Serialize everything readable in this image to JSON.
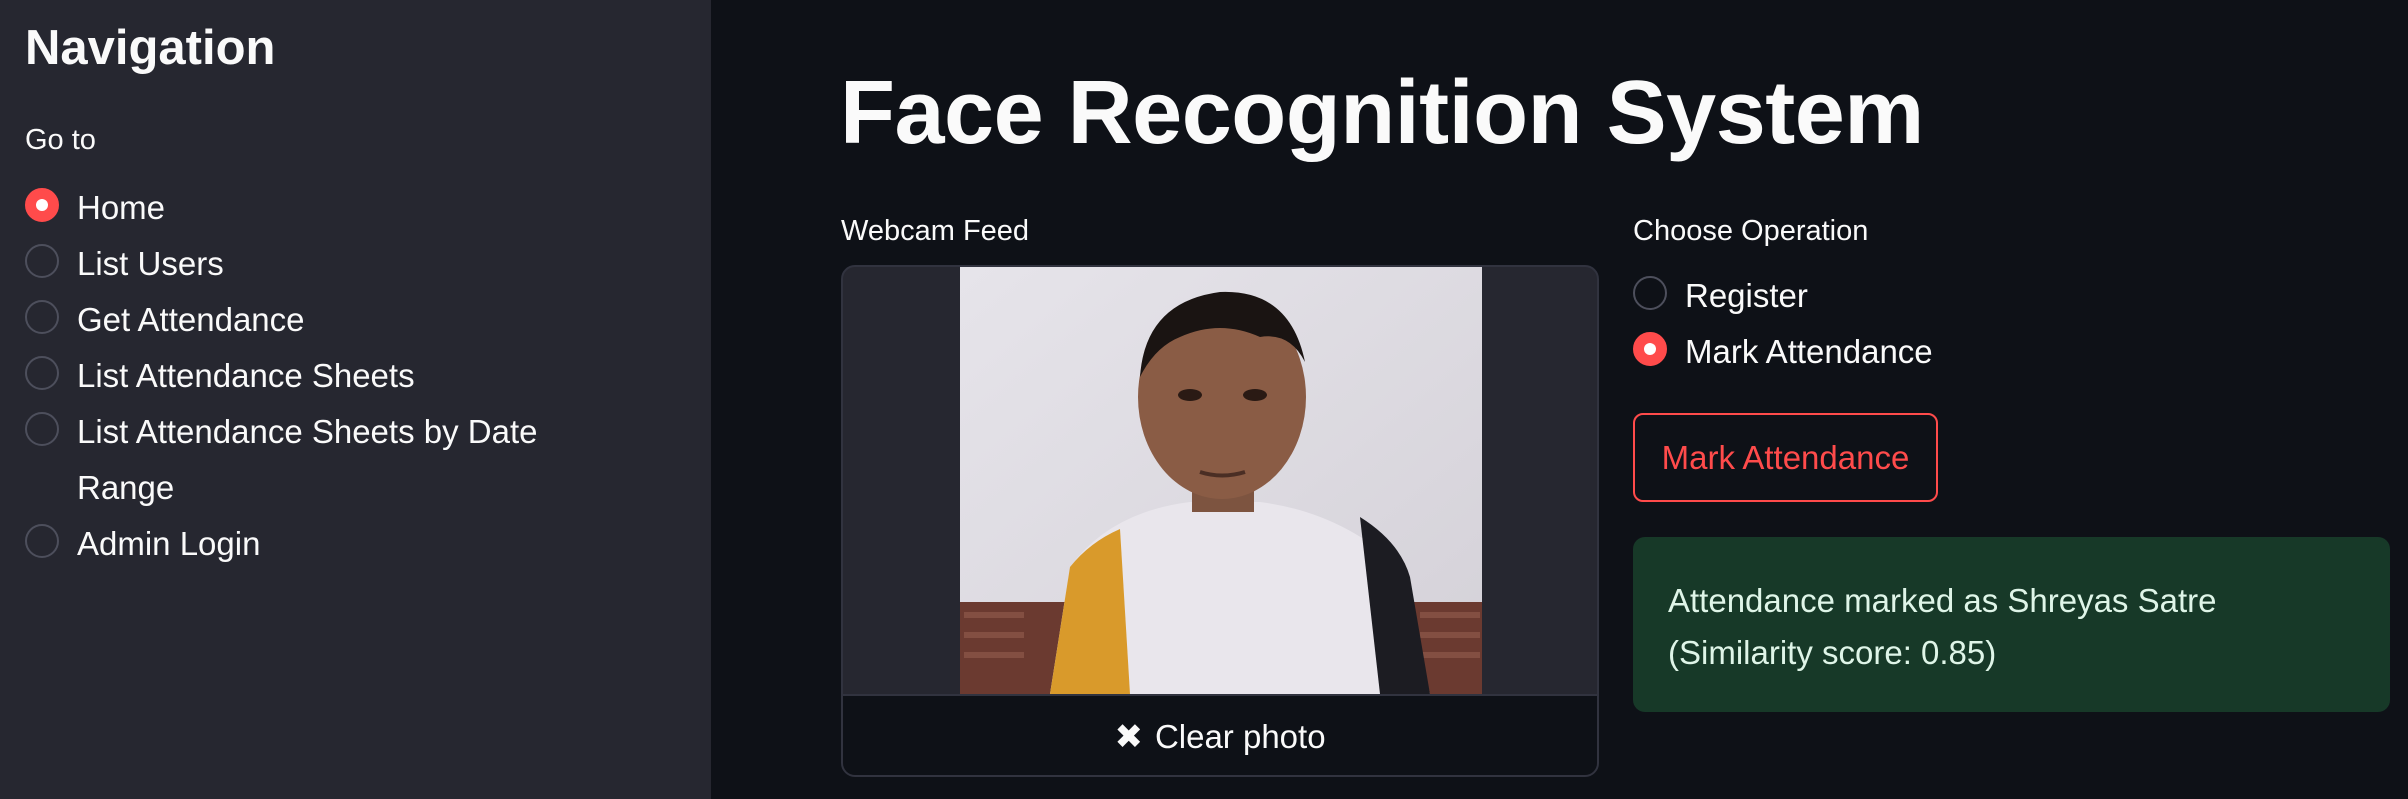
{
  "sidebar": {
    "title": "Navigation",
    "goto_label": "Go to",
    "items": [
      {
        "label": "Home",
        "selected": true
      },
      {
        "label": "List Users",
        "selected": false
      },
      {
        "label": "Get Attendance",
        "selected": false
      },
      {
        "label": "List Attendance Sheets",
        "selected": false
      },
      {
        "label": "List Attendance Sheets by Date Range",
        "selected": false
      },
      {
        "label": "Admin Login",
        "selected": false
      }
    ]
  },
  "main": {
    "title": "Face Recognition System",
    "webcam": {
      "label": "Webcam Feed",
      "clear_icon": "close-icon",
      "clear_label": "Clear photo"
    },
    "operation": {
      "label": "Choose Operation",
      "options": [
        {
          "label": "Register",
          "selected": false
        },
        {
          "label": "Mark Attendance",
          "selected": true
        }
      ]
    },
    "mark_button_label": "Mark Attendance",
    "success": {
      "line1": "Attendance marked as Shreyas Satre",
      "line2": "(Similarity score: 0.85)"
    }
  },
  "colors": {
    "accent": "#ff4b4b",
    "sidebar_bg": "#262730",
    "main_bg": "#0e1117",
    "success_bg": "#173928"
  }
}
